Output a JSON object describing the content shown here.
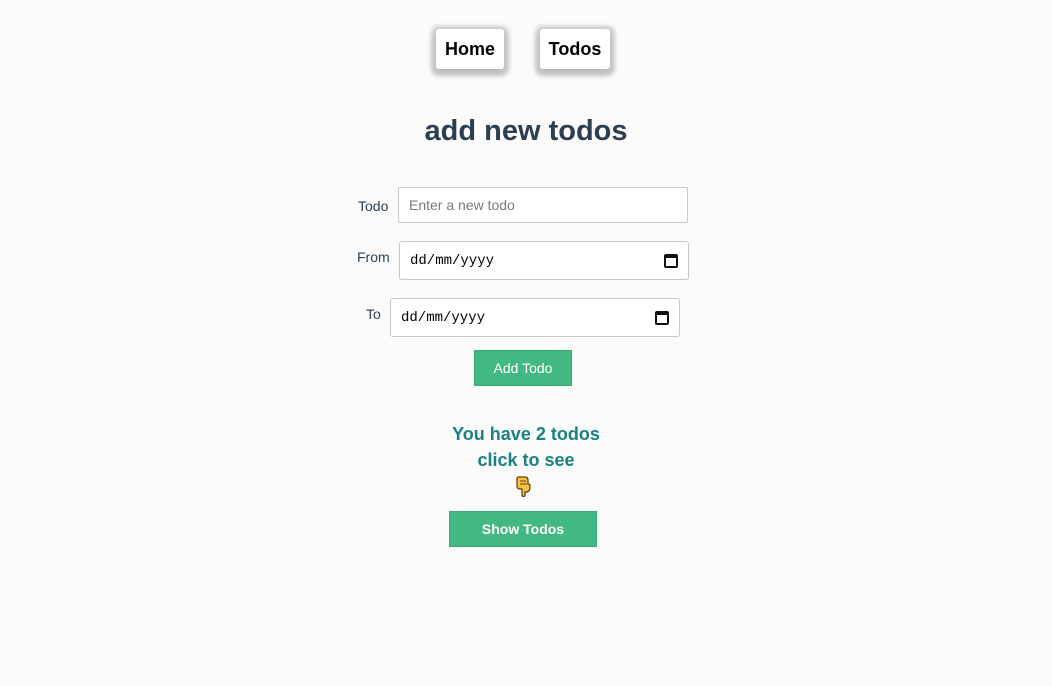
{
  "nav": {
    "items": [
      {
        "label": "Home"
      },
      {
        "label": "Todos"
      }
    ]
  },
  "page": {
    "title": "add new todos"
  },
  "form": {
    "todo_label": "Todo",
    "todo_placeholder": "Enter a new todo",
    "todo_value": "",
    "from_label": "From",
    "from_value": "dd/mm/yyyy",
    "to_label": "To",
    "to_value": "dd/mm/yyyy",
    "add_button": "Add Todo"
  },
  "summary": {
    "count_text": "You have 2 todos",
    "hint_text": "click to see",
    "hint_icon": "pointing-down-hand-icon",
    "show_button": "Show Todos"
  },
  "colors": {
    "accent": "#42b983",
    "title": "#2c3e50",
    "count": "#1a8080",
    "background": "#fbfbfb"
  }
}
